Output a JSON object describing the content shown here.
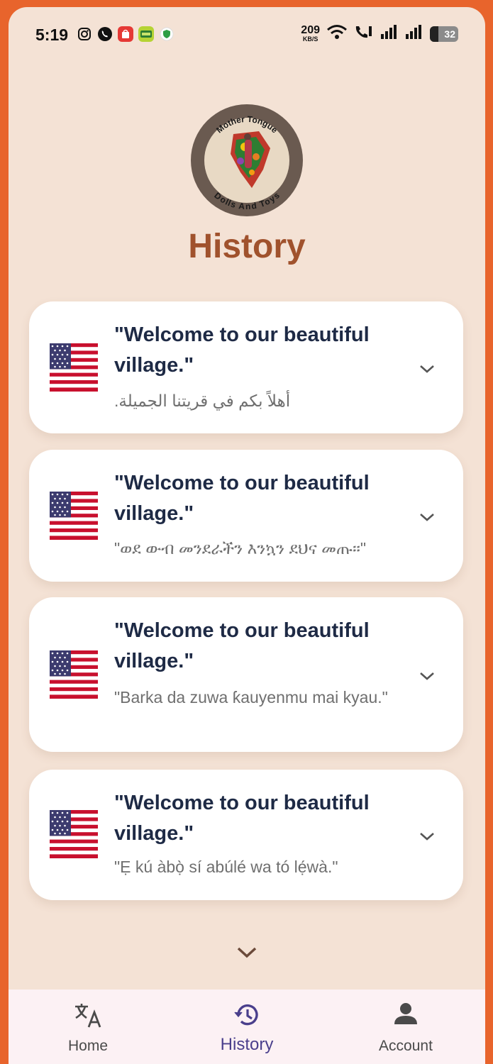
{
  "status_bar": {
    "time": "5:19",
    "net_speed_value": "209",
    "net_speed_unit": "KB/S",
    "battery": "32"
  },
  "logo": {
    "top_text": "Mother Tongue",
    "bottom_text": "Dolls And Toys"
  },
  "page": {
    "title": "History"
  },
  "history": [
    {
      "source": "\"Welcome to our beautiful village.\"",
      "translation": "أهلاً بكم في قريتنا الجميلة."
    },
    {
      "source": "\"Welcome to our beautiful village.\"",
      "translation": "\"ወደ ውብ መንደራችን እንኳን ደህና መጡ።\""
    },
    {
      "source": "\"Welcome to our beautiful village.\"",
      "translation": "\"Barka da zuwa ƙauyenmu mai kyau.\""
    },
    {
      "source": "\"Welcome to our beautiful village.\"",
      "translation": "\"Ẹ kú àbọ̀ sí abúlé wa tó lẹ́wà.\""
    }
  ],
  "nav": {
    "items": [
      {
        "label": "Home",
        "icon": "translate-icon"
      },
      {
        "label": "History",
        "icon": "history-icon"
      },
      {
        "label": "Account",
        "icon": "account-icon"
      }
    ]
  },
  "colors": {
    "frame": "#E8642C",
    "background": "#F4E2D5",
    "title": "#A0522D",
    "nav_active": "#4A3F8C"
  }
}
